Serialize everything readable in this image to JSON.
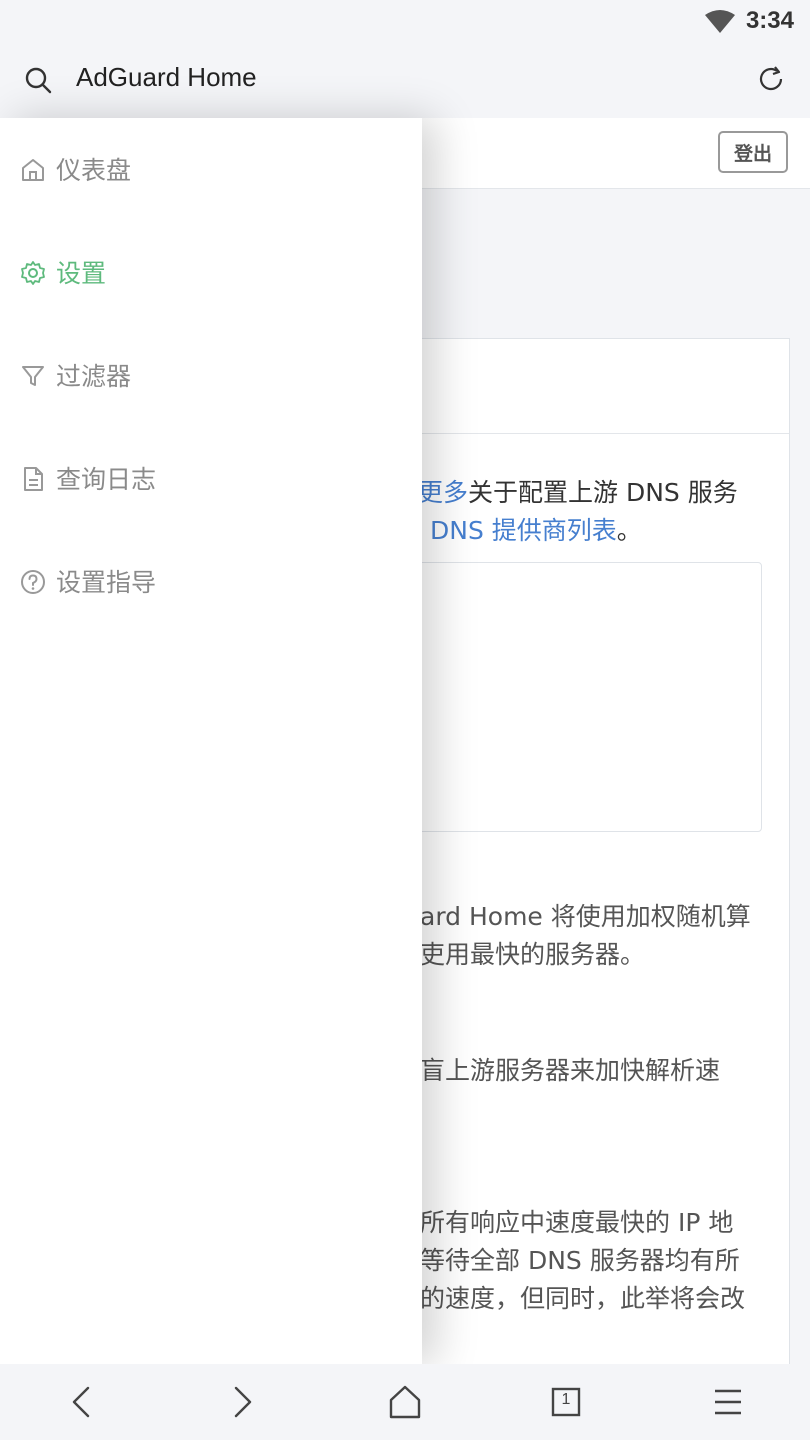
{
  "status_bar": {
    "time": "3:34",
    "wifi_icon": "wifi-icon"
  },
  "browser": {
    "title": "AdGuard Home",
    "search_icon": "search-icon",
    "refresh_icon": "refresh-icon"
  },
  "header": {
    "logout_label": "登出"
  },
  "drawer": {
    "items": [
      {
        "label": "仪表盘",
        "icon": "home-icon",
        "active": false
      },
      {
        "label": "设置",
        "icon": "gear-icon",
        "active": true
      },
      {
        "label": "过滤器",
        "icon": "filter-icon",
        "active": false
      },
      {
        "label": "查询日志",
        "icon": "document-icon",
        "active": false
      },
      {
        "label": "设置指导",
        "icon": "help-icon",
        "active": false
      }
    ]
  },
  "content": {
    "intro_link1": "更多",
    "intro_text1": "关于配置上游 DNS 服务",
    "intro_link2": "DNS 提供商列表",
    "intro_text2": "。",
    "load_balance_line1": "ard Home 将使用加权随机算",
    "load_balance_line2": "吏用最快的服务器。",
    "parallel_line1": "盲上游服务器来加快解析速",
    "fastest_line1": "所有响应中速度最快的 IP 地",
    "fastest_line2": "等待全部 DNS 服务器均有所",
    "fastest_line3": "的速度，但同时，此举将会改"
  },
  "bottom_nav": {
    "tab_count": "1",
    "icons": [
      "back-icon",
      "forward-icon",
      "home-icon",
      "tabs-icon",
      "menu-icon"
    ]
  },
  "colors": {
    "accent_green": "#5eba7d",
    "link_blue": "#467fcf",
    "muted": "#8a8a8a"
  }
}
